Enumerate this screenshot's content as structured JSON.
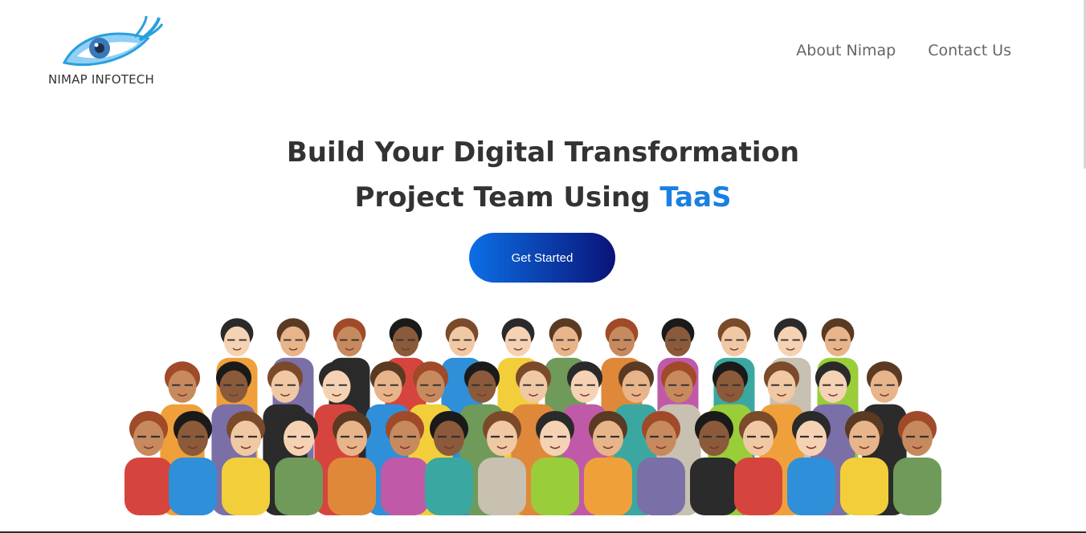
{
  "header": {
    "logo_text": "NIMAP INFOTECH",
    "logo_icon": "eye-logo-icon",
    "nav": [
      {
        "label": "About Nimap"
      },
      {
        "label": "Contact Us"
      }
    ]
  },
  "hero": {
    "title_line1": "Build Your Digital Transformation",
    "title_line2_prefix": "Project Team Using ",
    "title_line2_accent": "TaaS",
    "cta_label": "Get Started",
    "illustration": "team-crowd-illustration"
  },
  "colors": {
    "accent": "#1a7fe0",
    "cta_start": "#0c6fe6",
    "cta_end": "#0a1378",
    "text": "#333333",
    "nav_text": "#666666"
  }
}
